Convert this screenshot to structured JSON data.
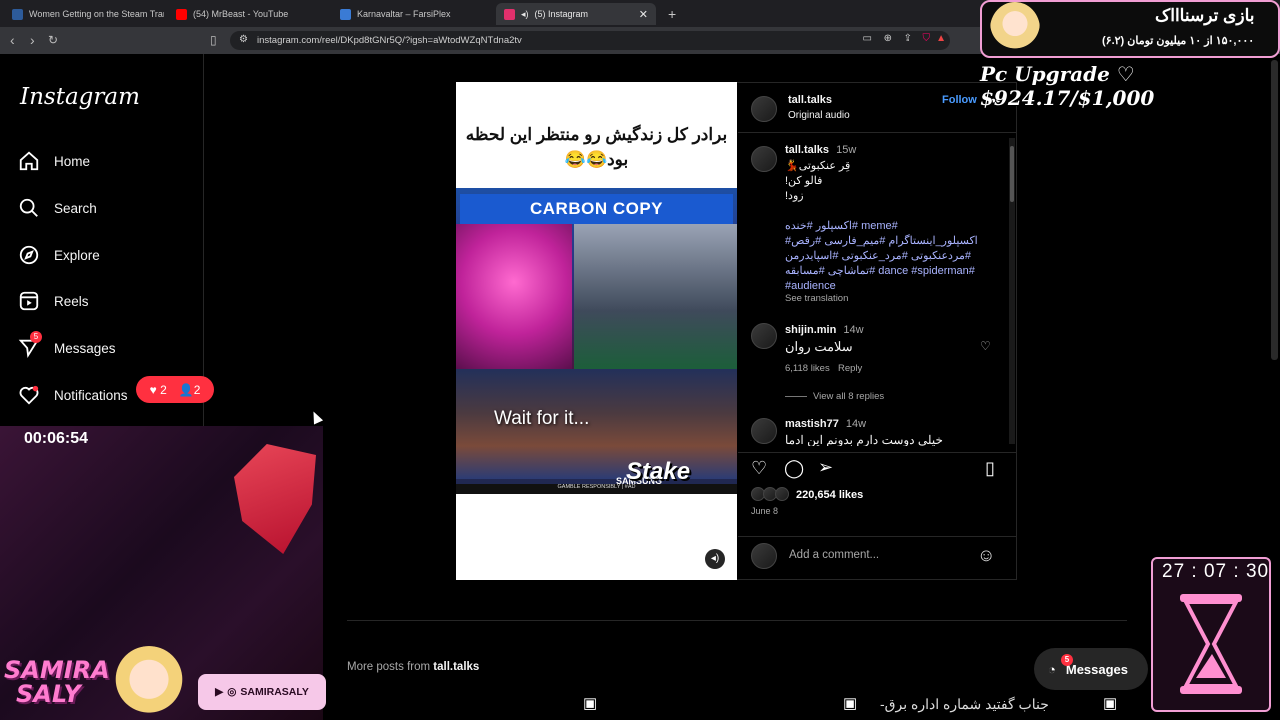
{
  "browser": {
    "tabs": [
      {
        "title": "Women Getting on the Steam Tram",
        "fav_color": "#2d5b9a"
      },
      {
        "title": "(54) MrBeast - YouTube",
        "fav_color": "#ff0000"
      },
      {
        "title": "Karnavaltar – FarsiPlex",
        "fav_color": "#3a7bd5"
      },
      {
        "title": "(5) Instagram",
        "fav_color": "#e1306c"
      }
    ],
    "new_tab": "+",
    "url": "instagram.com/reel/DKpd8tGNr5Q/?igsh=aWtodWZqNTdna2tv"
  },
  "sidebar": {
    "logo": "Instagram",
    "items": [
      {
        "label": "Home"
      },
      {
        "label": "Search"
      },
      {
        "label": "Explore"
      },
      {
        "label": "Reels"
      },
      {
        "label": "Messages",
        "badge": "5"
      },
      {
        "label": "Notifications"
      }
    ],
    "notif_pill": {
      "likes": "2",
      "follows": "2"
    }
  },
  "stream": {
    "cam_timer": "00:06:54",
    "streamer_name_1": "SAMIRA",
    "streamer_name_2": "SALY",
    "social_handle": "SAMIRASALY",
    "game_title": "بازی ترسناااک",
    "game_progress": "۱۵۰,۰۰۰ از ۱۰ میلیون تومان (۶.۲)",
    "upgrade_goal": "Pc Upgrade ♡ $924.17/$1,000",
    "hourglass_timer": "27 : 07 : 30",
    "ticker": "جناب گفتید شماره اداره برق-"
  },
  "post": {
    "media_caption": "برادر کل زندگیش رو منتظر این لحظه بود😂😂",
    "banner": "CARBON COPY",
    "overlay_text": "Wait for it...",
    "sponsor": "Stake",
    "scoreboard": "SAMSUNG",
    "disclaimer": "GAMBLE RESPONSIBLY | #AD",
    "author": "tall.talks",
    "audio": "Original audio",
    "follow": "Follow",
    "caption_author": "tall.talks",
    "caption_time": "15w",
    "caption_line1": "قِر عنکبوتی💃",
    "caption_line2": "فالو کن!",
    "caption_line3": "زود!",
    "hashtags_1": "#meme #اکسپلور #خنده",
    "hashtags_2": "اکسپلور_اینستاگرام #میم_فارسی #رقص#",
    "hashtags_3": "#مردعنکبوتی #مرد_عنکبوتی #اسپایدرمن",
    "hashtags_4": "#dance #spiderman #تماشاچی #مسابقه",
    "hashtags_5": "#audience",
    "see_translation": "See translation",
    "comments": [
      {
        "user": "shijin.min",
        "time": "14w",
        "text": "سلامت روان",
        "likes": "6,118 likes",
        "reply": "Reply",
        "view_replies": "View all 8 replies"
      },
      {
        "user": "mastish77",
        "time": "14w",
        "text": "خیلی دوست دارم بدونم این ادما"
      }
    ],
    "likes": "220,654 likes",
    "date": "June 8",
    "add_comment_placeholder": "Add a comment..."
  },
  "bottom": {
    "more_posts_prefix": "More posts from",
    "more_posts_user": "tall.talks",
    "messages_button": "Messages",
    "messages_badge": "5"
  }
}
